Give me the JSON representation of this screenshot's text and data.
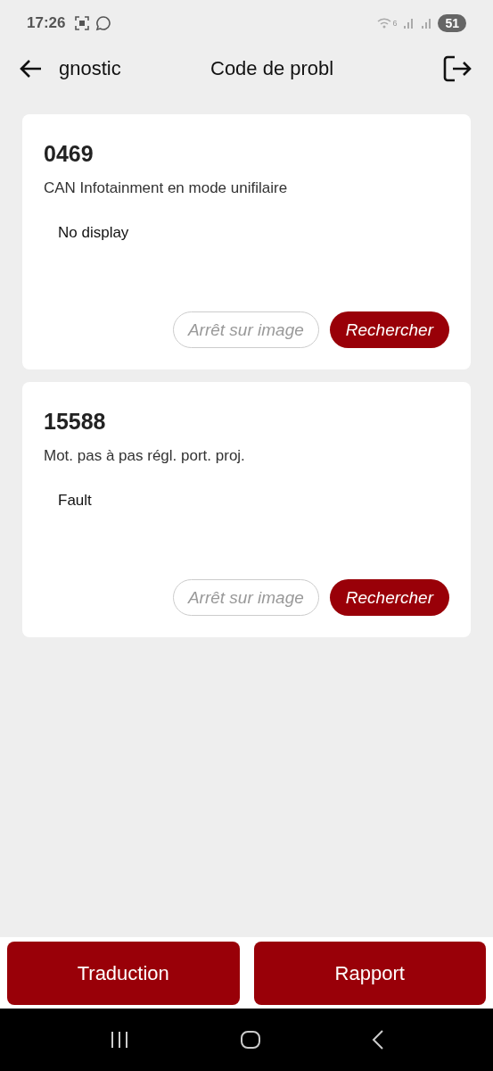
{
  "status_bar": {
    "time": "17:26",
    "wifi_label": "6",
    "battery": "51"
  },
  "header": {
    "back_title": "gnostic",
    "title": "Code de probl"
  },
  "faults": [
    {
      "code": "0469",
      "description": "CAN Infotainment en mode unifilaire",
      "status": "No display",
      "secondary_button": "Arrêt sur image",
      "primary_button": "Rechercher"
    },
    {
      "code": "15588",
      "description": "Mot. pas à pas régl. port. proj.",
      "status": "Fault",
      "secondary_button": "Arrêt sur image",
      "primary_button": "Rechercher"
    }
  ],
  "bottom_buttons": [
    "Traduction",
    "Rapport"
  ]
}
